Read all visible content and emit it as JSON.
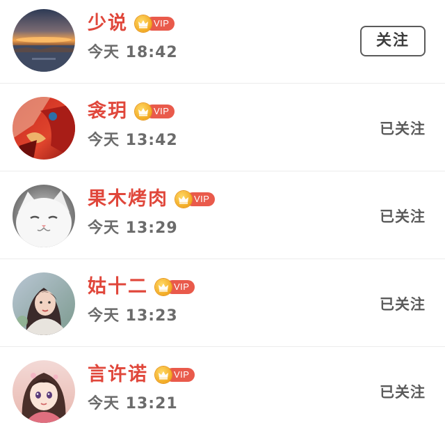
{
  "vip_badge_text": "VIP",
  "colors": {
    "username": "#e0473b",
    "vip_tag": "#e95a4b",
    "vip_crown": "#f1a71f",
    "time": "#6b6b6b",
    "divider": "#ececec"
  },
  "users": [
    {
      "name": "少说",
      "time": "今天 18:42",
      "vip": true,
      "follow_state": "关注",
      "is_following": false,
      "avatar": "sunset-landscape-avatar"
    },
    {
      "name": "衾玥",
      "time": "今天 13:42",
      "vip": true,
      "follow_state": "已关注",
      "is_following": true,
      "avatar": "red-hanfu-avatar"
    },
    {
      "name": "果木烤肉",
      "time": "今天 13:29",
      "vip": true,
      "follow_state": "已关注",
      "is_following": true,
      "avatar": "white-cat-avatar"
    },
    {
      "name": "姑十二",
      "time": "今天 13:23",
      "vip": true,
      "follow_state": "已关注",
      "is_following": true,
      "avatar": "girl-portrait-avatar"
    },
    {
      "name": "言许诺",
      "time": "今天 13:21",
      "vip": true,
      "follow_state": "已关注",
      "is_following": true,
      "avatar": "anime-girl-avatar"
    }
  ]
}
